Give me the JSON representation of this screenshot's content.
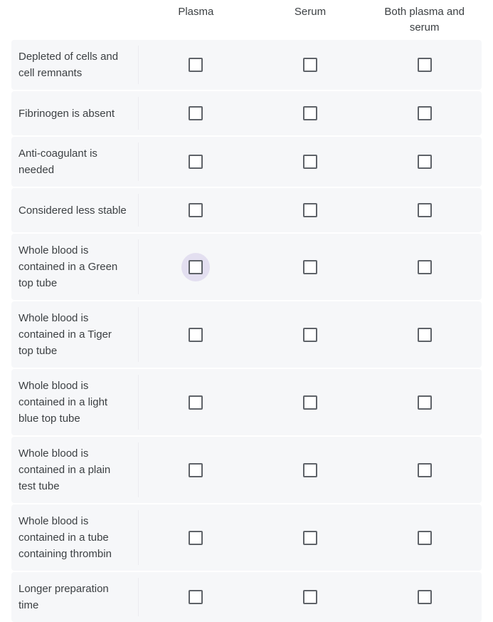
{
  "matrix": {
    "columns": [
      {
        "label": "Plasma",
        "name": "column-plasma"
      },
      {
        "label": "Serum",
        "name": "column-serum"
      },
      {
        "label": "Both plasma and serum",
        "name": "column-both-plasma-and-serum"
      }
    ],
    "rows": [
      {
        "label": "Depleted of cells and cell remnants",
        "options": [
          {
            "checked": false,
            "hovered": false
          },
          {
            "checked": false,
            "hovered": false
          },
          {
            "checked": false,
            "hovered": false
          }
        ]
      },
      {
        "label": "Fibrinogen is absent",
        "options": [
          {
            "checked": false,
            "hovered": false
          },
          {
            "checked": false,
            "hovered": false
          },
          {
            "checked": false,
            "hovered": false
          }
        ]
      },
      {
        "label": "Anti-coagulant is needed",
        "options": [
          {
            "checked": false,
            "hovered": false
          },
          {
            "checked": false,
            "hovered": false
          },
          {
            "checked": false,
            "hovered": false
          }
        ]
      },
      {
        "label": "Considered less stable",
        "options": [
          {
            "checked": false,
            "hovered": false
          },
          {
            "checked": false,
            "hovered": false
          },
          {
            "checked": false,
            "hovered": false
          }
        ]
      },
      {
        "label": "Whole blood is contained in a Green top tube",
        "options": [
          {
            "checked": false,
            "hovered": true
          },
          {
            "checked": false,
            "hovered": false
          },
          {
            "checked": false,
            "hovered": false
          }
        ]
      },
      {
        "label": "Whole blood is contained in a Tiger top tube",
        "options": [
          {
            "checked": false,
            "hovered": false
          },
          {
            "checked": false,
            "hovered": false
          },
          {
            "checked": false,
            "hovered": false
          }
        ]
      },
      {
        "label": "Whole blood is contained in a light blue top tube",
        "options": [
          {
            "checked": false,
            "hovered": false
          },
          {
            "checked": false,
            "hovered": false
          },
          {
            "checked": false,
            "hovered": false
          }
        ]
      },
      {
        "label": "Whole blood is contained in a plain test tube",
        "options": [
          {
            "checked": false,
            "hovered": false
          },
          {
            "checked": false,
            "hovered": false
          },
          {
            "checked": false,
            "hovered": false
          }
        ]
      },
      {
        "label": "Whole blood is contained in a tube containing thrombin",
        "options": [
          {
            "checked": false,
            "hovered": false
          },
          {
            "checked": false,
            "hovered": false
          },
          {
            "checked": false,
            "hovered": false
          }
        ]
      },
      {
        "label": "Longer preparation time",
        "options": [
          {
            "checked": false,
            "hovered": false
          },
          {
            "checked": false,
            "hovered": false
          },
          {
            "checked": false,
            "hovered": false
          }
        ]
      }
    ],
    "colors": {
      "row_background": "#f6f7f9",
      "page_background": "#ffffff",
      "text": "#3c4043",
      "checkbox_border": "#5f6369",
      "checkbox_fill": "#ffffff",
      "hover_ripple": "#e3dff0",
      "divider": "#ececf0"
    }
  }
}
